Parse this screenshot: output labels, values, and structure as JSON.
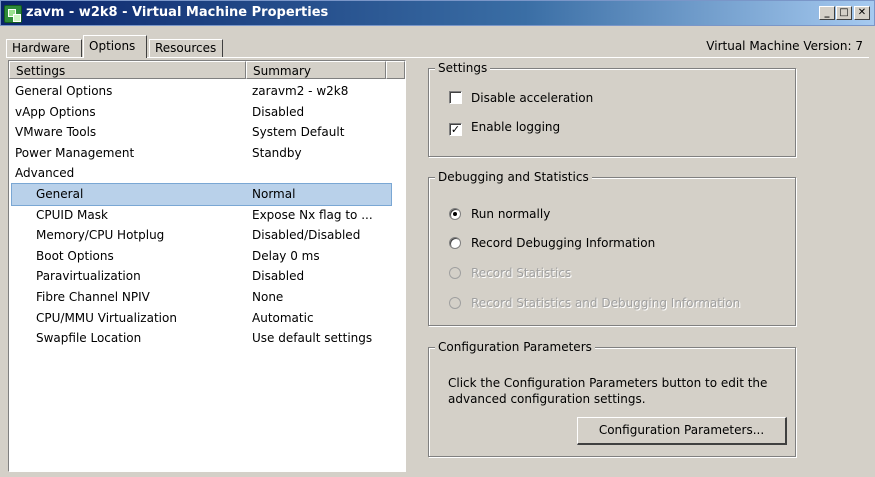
{
  "window": {
    "title": "zavm - w2k8 - Virtual Machine Properties",
    "buttons": {
      "minimize": "_",
      "maximize": "□",
      "close": "✕"
    }
  },
  "tabs": [
    {
      "label": "Hardware",
      "active": false
    },
    {
      "label": "Options",
      "active": true
    },
    {
      "label": "Resources",
      "active": false
    }
  ],
  "vm_version": "Virtual Machine Version: 7",
  "list": {
    "headers": {
      "settings": "Settings",
      "summary": "Summary"
    },
    "rows": [
      {
        "setting": "General Options",
        "summary": "zaravm2 - w2k8",
        "child": false,
        "selected": false
      },
      {
        "setting": "vApp Options",
        "summary": "Disabled",
        "child": false,
        "selected": false
      },
      {
        "setting": "VMware Tools",
        "summary": "System Default",
        "child": false,
        "selected": false
      },
      {
        "setting": "Power Management",
        "summary": "Standby",
        "child": false,
        "selected": false
      },
      {
        "setting": "Advanced",
        "summary": "",
        "child": false,
        "selected": false
      },
      {
        "setting": "General",
        "summary": "Normal",
        "child": true,
        "selected": true
      },
      {
        "setting": "CPUID Mask",
        "summary": "Expose Nx flag to ...",
        "child": true,
        "selected": false
      },
      {
        "setting": "Memory/CPU Hotplug",
        "summary": "Disabled/Disabled",
        "child": true,
        "selected": false
      },
      {
        "setting": "Boot Options",
        "summary": "Delay 0 ms",
        "child": true,
        "selected": false
      },
      {
        "setting": "Paravirtualization",
        "summary": "Disabled",
        "child": true,
        "selected": false
      },
      {
        "setting": "Fibre Channel NPIV",
        "summary": "None",
        "child": true,
        "selected": false
      },
      {
        "setting": "CPU/MMU Virtualization",
        "summary": "Automatic",
        "child": true,
        "selected": false
      },
      {
        "setting": "Swapfile Location",
        "summary": "Use default settings",
        "child": true,
        "selected": false
      }
    ]
  },
  "settings_group": {
    "title": "Settings",
    "disable_acceleration": {
      "label": "Disable acceleration",
      "checked": false
    },
    "enable_logging": {
      "label": "Enable logging",
      "checked": true
    }
  },
  "debug_group": {
    "title": "Debugging and Statistics",
    "options": [
      {
        "label": "Run normally",
        "selected": true,
        "enabled": true
      },
      {
        "label": "Record Debugging Information",
        "selected": false,
        "enabled": true
      },
      {
        "label": "Record Statistics",
        "selected": false,
        "enabled": false
      },
      {
        "label": "Record Statistics and Debugging Information",
        "selected": false,
        "enabled": false
      }
    ]
  },
  "config_group": {
    "title": "Configuration Parameters",
    "description": "Click the Configuration Parameters button to edit the advanced configuration settings.",
    "button_label": "Configuration Parameters..."
  }
}
